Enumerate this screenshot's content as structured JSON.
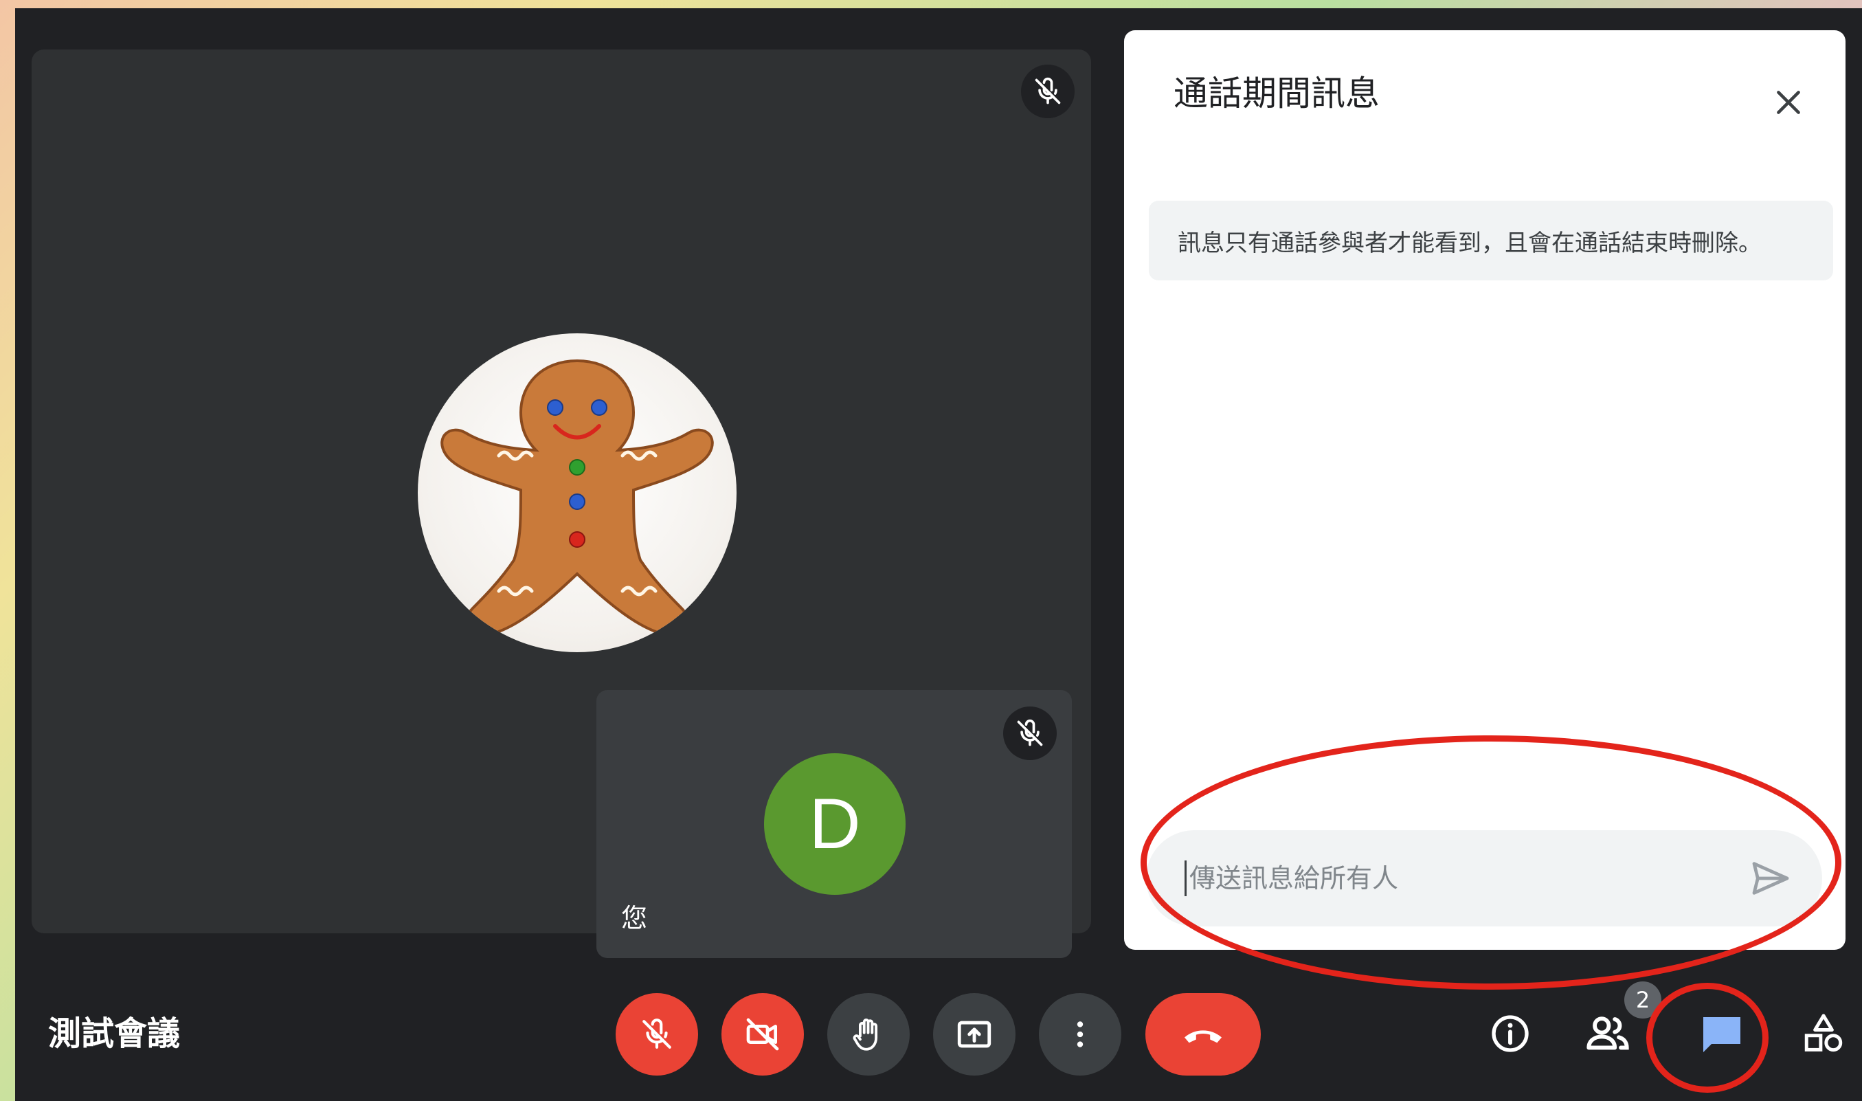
{
  "chat_panel": {
    "title": "通話期間訊息",
    "notice": "訊息只有通話參與者才能看到，且會在通話結束時刪除。",
    "input_placeholder": "傳送訊息給所有人"
  },
  "self_tile": {
    "avatar_letter": "D",
    "label": "您"
  },
  "meeting": {
    "name": "測試會議"
  },
  "toolbar": {
    "people_count": "2"
  },
  "colors": {
    "mute_red": "#ea4335",
    "chat_active": "#8ab4f8",
    "annotation_red": "#e3241b",
    "self_avatar": "#5a992f"
  },
  "icons": {
    "mic": "mic-off-icon",
    "camera": "videocam-off-icon",
    "hand": "raise-hand-icon",
    "present": "present-screen-icon",
    "more": "more-vert-icon",
    "end": "call-end-icon",
    "info": "info-icon",
    "people": "people-icon",
    "chat": "chat-icon",
    "activities": "activities-icon",
    "send": "send-icon",
    "close": "close-icon"
  }
}
